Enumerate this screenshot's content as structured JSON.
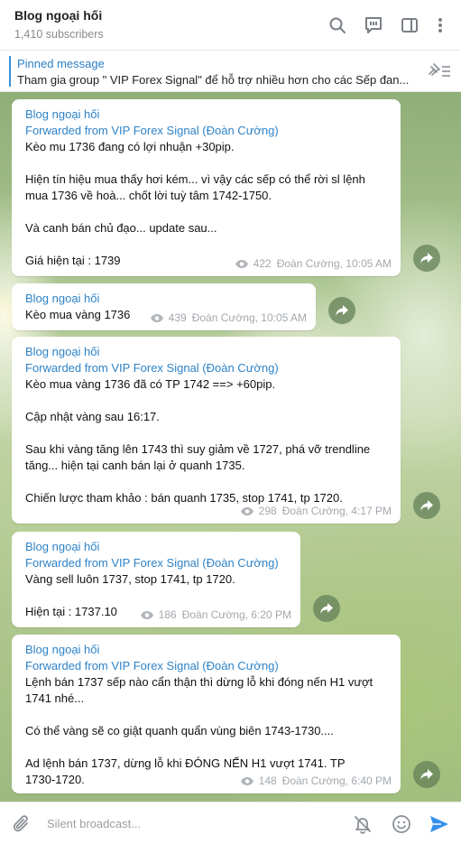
{
  "header": {
    "title": "Blog ngoại hối",
    "subscribers": "1,410 subscribers",
    "icons": [
      "search-icon",
      "discussion-icon",
      "sidebar-toggle-icon",
      "more-icon"
    ]
  },
  "pinned": {
    "title": "Pinned message",
    "text": "Tham gia group \" VIP Forex Signal\" để hỗ trợ nhiều hơn cho các Sếp đan..."
  },
  "messages": [
    {
      "author": "Blog ngoại hối",
      "forwarded": "Forwarded from VIP Forex Signal (Đoàn Cường)",
      "lines": [
        "Kèo mu 1736 đang có lợi nhuận +30pip.",
        "",
        "Hiện tín hiệu mua thấy hơi kém... vì vậy các sếp có thể rời sl lệnh",
        "mua 1736 về hoà... chốt lời tuỳ tâm 1742-1750.",
        "",
        "Và canh bán chủ đạo... update sau...",
        "",
        "Giá hiện tại : 1739"
      ],
      "views": "422",
      "meta": "Đoàn Cường, 10:05 AM"
    },
    {
      "author": "Blog ngoại hối",
      "forwarded": "",
      "lines": [
        "Kèo mua vàng 1736"
      ],
      "views": "439",
      "meta": "Đoàn Cường, 10:05 AM"
    },
    {
      "author": "Blog ngoại hối",
      "forwarded": "Forwarded from VIP Forex Signal (Đoàn Cường)",
      "lines": [
        "Kèo mua vàng 1736 đã có TP 1742 ==> +60pip.",
        "",
        "Cập nhật vàng sau 16:17.",
        "",
        "Sau khi vàng tăng lên 1743 thì suy giảm về 1727, phá vỡ trendline",
        "tăng... hiện tại canh bán lại ở quanh 1735.",
        "",
        "Chiến lược tham khảo : bán quanh 1735, stop 1741, tp 1720."
      ],
      "views": "298",
      "meta": "Đoàn Cường, 4:17 PM"
    },
    {
      "author": "Blog ngoại hối",
      "forwarded": "Forwarded from VIP Forex Signal (Đoàn Cường)",
      "lines": [
        "Vàng sell luôn 1737, stop 1741, tp 1720.",
        "",
        "Hiện tại : 1737.10"
      ],
      "views": "186",
      "meta": "Đoàn Cường, 6:20 PM"
    },
    {
      "author": "Blog ngoại hối",
      "forwarded": "Forwarded from VIP Forex Signal (Đoàn Cường)",
      "lines": [
        "Lệnh bán 1737 sếp nào cẩn thận thì dừng lỗ khi đóng nến H1 vượt",
        "1741 nhé...",
        "",
        "Có thể vàng sẽ co giật quanh quẩn vùng biên 1743-1730....",
        "",
        "Ad lệnh bán 1737, dừng lỗ khi ĐÓNG NẾN H1 vượt 1741. TP",
        "1730-1720."
      ],
      "views": "148",
      "meta": "Đoàn Cường, 6:40 PM"
    }
  ],
  "composer": {
    "placeholder": "Silent broadcast...",
    "icons": [
      "attach-icon",
      "mute-bell-icon",
      "emoji-icon",
      "send-icon"
    ]
  },
  "colors": {
    "accent": "#2e83c8",
    "send": "#3390ec",
    "meta": "#a3a8ad"
  }
}
